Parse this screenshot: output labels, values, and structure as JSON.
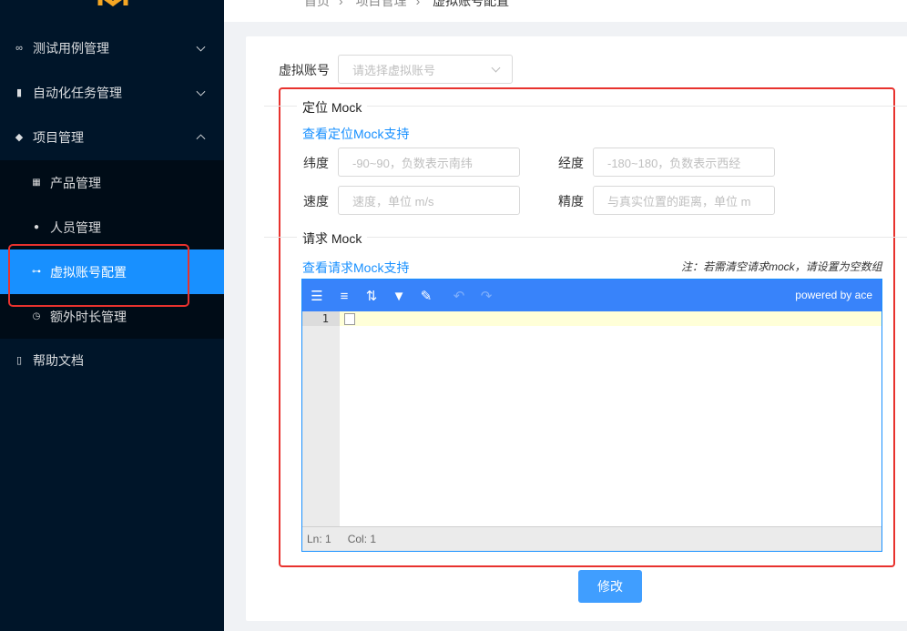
{
  "sidebar": {
    "menu": [
      {
        "label": "测试用例管理",
        "icon": "infinity-icon",
        "expanded": false
      },
      {
        "label": "自动化任务管理",
        "icon": "bar-chart-icon",
        "expanded": false
      },
      {
        "label": "项目管理",
        "icon": "layers-icon",
        "expanded": true
      },
      {
        "label": "帮助文档",
        "icon": "book-icon"
      }
    ],
    "submenu": [
      {
        "label": "产品管理",
        "icon": "grid-icon"
      },
      {
        "label": "人员管理",
        "icon": "team-icon"
      },
      {
        "label": "虚拟账号配置",
        "icon": "glasses-icon",
        "active": true
      },
      {
        "label": "额外时长管理",
        "icon": "clock-icon"
      }
    ]
  },
  "breadcrumb": [
    "首页",
    "项目管理",
    "虚拟账号配置"
  ],
  "form": {
    "account_label": "虚拟账号",
    "account_placeholder": "请选择虚拟账号",
    "location": {
      "title": "定位 Mock",
      "help_link": "查看定位Mock支持",
      "lat_label": "纬度",
      "lat_placeholder": "-90~90，负数表示南纬",
      "lng_label": "经度",
      "lng_placeholder": "-180~180，负数表示西经",
      "speed_label": "速度",
      "speed_placeholder": "速度，单位 m/s",
      "accuracy_label": "精度",
      "accuracy_placeholder": "与真实位置的距离，单位 m"
    },
    "request": {
      "title": "请求 Mock",
      "help_link": "查看请求Mock支持",
      "note": "注：若需清空请求mock，请设置为空数组"
    },
    "editor": {
      "powered_by": "powered by ace",
      "line_number": "1",
      "status_ln": "Ln: 1",
      "status_col": "Col: 1"
    },
    "submit_label": "修改"
  },
  "colors": {
    "sidebar_bg": "#001529",
    "accent": "#1890ff",
    "highlight": "#e8322e",
    "editor_toolbar": "#3883fa"
  }
}
